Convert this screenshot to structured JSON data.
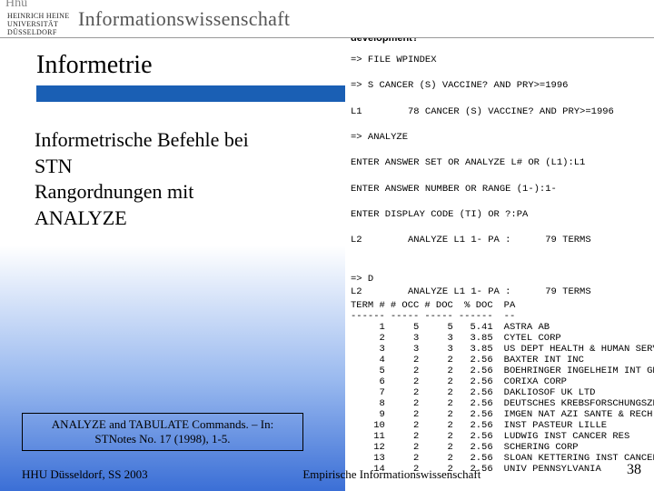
{
  "header": {
    "logo_sig": "Hhu",
    "logo_line1": "HEINRICH HEINE",
    "logo_line2": "UNIVERSITÄT",
    "logo_line3": "DÜSSELDORF",
    "dept": "Informationswissenschaft"
  },
  "title": "Informetrie",
  "body": {
    "line1": "Informetrische Befehle bei STN",
    "line2": "Rangordnungen mit ANALYZE"
  },
  "citation": {
    "l1": "ANALYZE and TABULATE Commands. – In:",
    "l2": "STNotes No. 17 (1998), 1-5."
  },
  "footer": {
    "left": "HHU Düsseldorf, SS 2003",
    "center": "Empirische Informationswissenschaft"
  },
  "slide_number": "38",
  "right": {
    "question": "In the last several years, what companies or organizations have applied for patents in the area of cancer vaccine development?",
    "cmds": [
      "=> FILE WPINDEX",
      "",
      "=> S CANCER (S) VACCINE? AND PRY>=1996",
      "",
      "L1        78 CANCER (S) VACCINE? AND PRY>=1996",
      "",
      "=> ANALYZE",
      "",
      "ENTER ANSWER SET OR ANALYZE L# OR (L1):L1",
      "",
      "ENTER ANSWER NUMBER OR RANGE (1-):1-",
      "",
      "ENTER DISPLAY CODE (TI) OR ?:PA",
      "",
      "L2        ANALYZE L1 1- PA :      79 TERMS",
      "",
      "",
      "=> D",
      "L2        ANALYZE L1 1- PA :      79 TERMS"
    ],
    "table": {
      "headers": [
        "TERM #",
        "# OCC",
        "# DOC",
        "% DOC",
        "PA"
      ],
      "dashes": [
        "------",
        "-----",
        "-----",
        "------",
        "--"
      ],
      "rows": [
        [
          "1",
          "5",
          "5",
          "5.41",
          "ASTRA AB"
        ],
        [
          "2",
          "3",
          "3",
          "3.85",
          "CYTEL CORP"
        ],
        [
          "3",
          "3",
          "3",
          "3.85",
          "US DEPT HEALTH & HUMAN SERVICES"
        ],
        [
          "4",
          "2",
          "2",
          "2.56",
          "BAXTER INT INC"
        ],
        [
          "5",
          "2",
          "2",
          "2.56",
          "BOEHRINGER INGELHEIM INT GMBH"
        ],
        [
          "6",
          "2",
          "2",
          "2.56",
          "CORIXA CORP"
        ],
        [
          "7",
          "2",
          "2",
          "2.56",
          "DAKLIOSOF UK LTD"
        ],
        [
          "8",
          "2",
          "2",
          "2.56",
          "DEUTSCHES KREBSFORSCHUNGSZENTRUM"
        ],
        [
          "9",
          "2",
          "2",
          "2.56",
          "IMGEN NAT AZI SANTE & RECH MEDICALE"
        ],
        [
          "10",
          "2",
          "2",
          "2.56",
          "INST PASTEUR LILLE"
        ],
        [
          "11",
          "2",
          "2",
          "2.56",
          "LUDWIG INST CANCER RES"
        ],
        [
          "12",
          "2",
          "2",
          "2.56",
          "SCHERING CORP"
        ],
        [
          "13",
          "2",
          "2",
          "2.56",
          "SLOAN KETTERING INST CANCER RES"
        ],
        [
          "14",
          "2",
          "2",
          "2.56",
          "UNIV PENNSYLVANIA"
        ]
      ]
    }
  }
}
